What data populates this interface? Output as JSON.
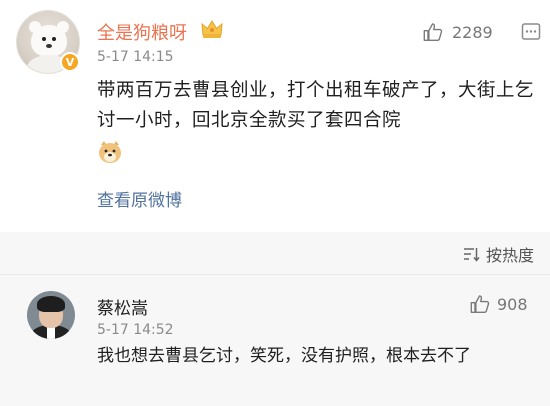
{
  "post": {
    "username": "全是狗粮呀",
    "time": "5-17 14:15",
    "likes": "2289",
    "text": "带两百万去曹县创业，打个出租车破产了，大街上乞讨一小时，回北京全款买了套四合院",
    "view_original": "查看原微博",
    "vip_badge": "V"
  },
  "sort": {
    "label": "按热度"
  },
  "comment": {
    "username": "蔡松嵩",
    "time": "5-17 14:52",
    "likes": "908",
    "text": "我也想去曹县乞讨，笑死，没有护照，根本去不了"
  },
  "colors": {
    "username": "#eb7350",
    "link": "#52739f",
    "vip": "#f5a623"
  },
  "icons": {
    "post_badge": "crown-icon",
    "like": "thumbs-up-icon",
    "more": "more-icon",
    "sort": "sort-icon",
    "emoji": "doge-emoji"
  }
}
